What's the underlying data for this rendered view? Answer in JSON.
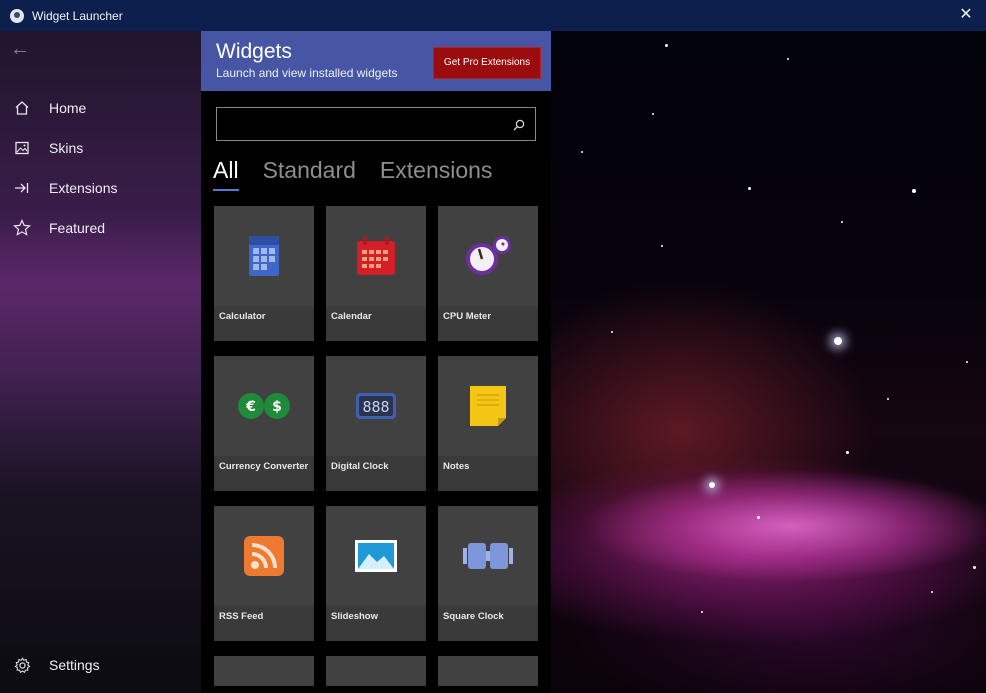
{
  "window": {
    "title": "Widget Launcher",
    "close_glyph": "✕",
    "icon": "app-icon"
  },
  "sidebar": {
    "back_glyph": "←",
    "items": [
      {
        "label": "Home",
        "icon": "home-icon"
      },
      {
        "label": "Skins",
        "icon": "image-icon"
      },
      {
        "label": "Extensions",
        "icon": "extensions-icon"
      },
      {
        "label": "Featured",
        "icon": "star-icon"
      }
    ],
    "settings": {
      "label": "Settings",
      "icon": "gear-icon"
    }
  },
  "panel": {
    "title": "Widgets",
    "subtitle": "Launch and view installed widgets",
    "pro_button": "Get Pro Extensions",
    "search": {
      "value": "",
      "placeholder": ""
    },
    "tabs": [
      {
        "label": "All",
        "active": true
      },
      {
        "label": "Standard",
        "active": false
      },
      {
        "label": "Extensions",
        "active": false
      }
    ],
    "widgets": [
      {
        "label": "Calculator",
        "icon": "calculator-icon"
      },
      {
        "label": "Calendar",
        "icon": "calendar-icon"
      },
      {
        "label": "CPU Meter",
        "icon": "cpu-meter-icon"
      },
      {
        "label": "Currency Converter",
        "icon": "currency-icon"
      },
      {
        "label": "Digital Clock",
        "icon": "digital-clock-icon"
      },
      {
        "label": "Notes",
        "icon": "notes-icon"
      },
      {
        "label": "RSS Feed",
        "icon": "rss-icon"
      },
      {
        "label": "Slideshow",
        "icon": "slideshow-icon"
      },
      {
        "label": "Square Clock",
        "icon": "square-clock-icon"
      }
    ],
    "currency_symbols": {
      "euro": "€",
      "dollar": "$"
    },
    "digital_clock_text": "888"
  },
  "colors": {
    "header_bg": "#4656a5",
    "pro_button_bg": "#9b0d0d",
    "tab_underline": "#5b78d6"
  }
}
